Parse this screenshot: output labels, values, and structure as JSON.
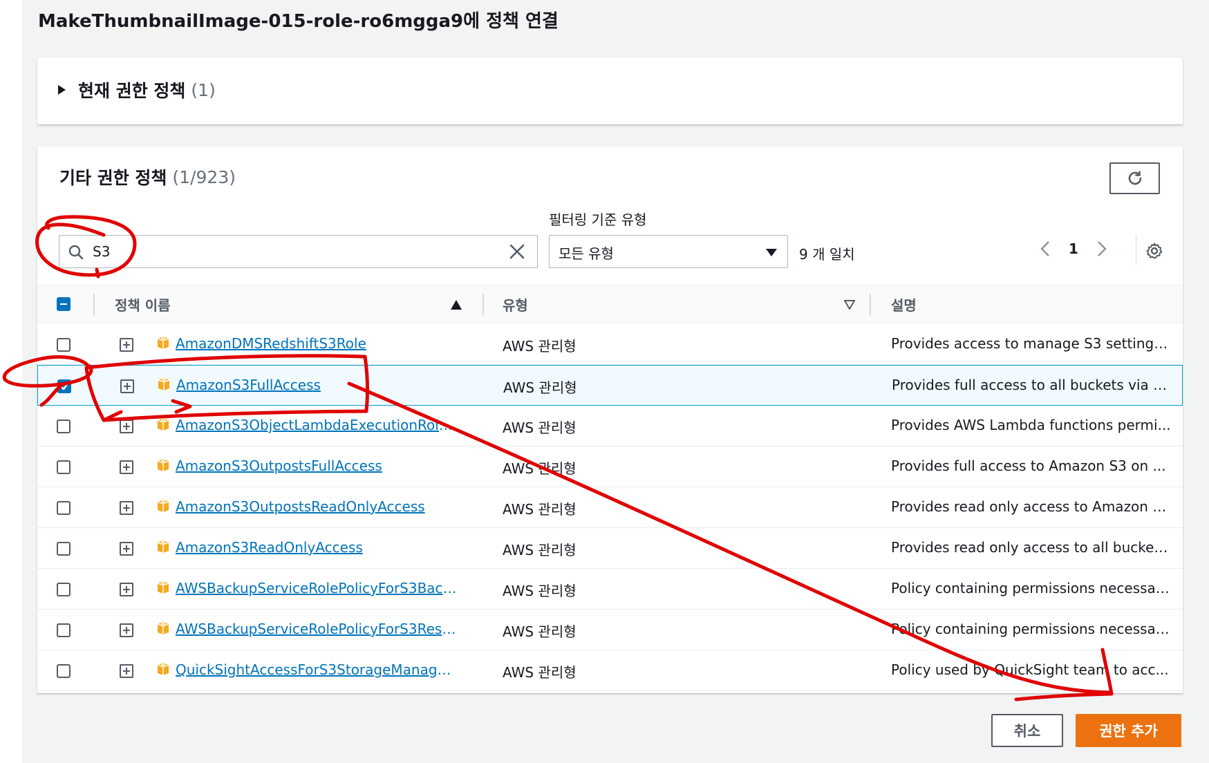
{
  "page": {
    "title": "MakeThumbnailImage-015-role-ro6mgga9에 정책 연결"
  },
  "current_policies": {
    "title": "현재 권한 정책",
    "count": "(1)"
  },
  "other_policies": {
    "title": "기타 권한 정책",
    "count": "(1/923)",
    "filter_type_label": "필터링 기준 유형",
    "search_value": "S3",
    "select_value": "모든 유형",
    "match_count": "9 개 일치",
    "page_number": "1",
    "columns": {
      "name": "정책 이름",
      "type": "유형",
      "description": "설명"
    },
    "rows": [
      {
        "name": "AmazonDMSRedshiftS3Role",
        "type": "AWS 관리형",
        "description": "Provides access to manage S3 settings ...",
        "checked": false
      },
      {
        "name": "AmazonS3FullAccess",
        "type": "AWS 관리형",
        "description": "Provides full access to all buckets via t...",
        "checked": true
      },
      {
        "name": "AmazonS3ObjectLambdaExecutionRoleP...",
        "type": "AWS 관리형",
        "description": "Provides AWS Lambda functions permi...",
        "checked": false
      },
      {
        "name": "AmazonS3OutpostsFullAccess",
        "type": "AWS 관리형",
        "description": "Provides full access to Amazon S3 on ...",
        "checked": false
      },
      {
        "name": "AmazonS3OutpostsReadOnlyAccess",
        "type": "AWS 관리형",
        "description": "Provides read only access to Amazon S...",
        "checked": false
      },
      {
        "name": "AmazonS3ReadOnlyAccess",
        "type": "AWS 관리형",
        "description": "Provides read only access to all bucket...",
        "checked": false
      },
      {
        "name": "AWSBackupServiceRolePolicyForS3Backup",
        "type": "AWS 관리형",
        "description": "Policy containing permissions necessar...",
        "checked": false
      },
      {
        "name": "AWSBackupServiceRolePolicyForS3Restore",
        "type": "AWS 관리형",
        "description": "Policy containing permissions necessar...",
        "checked": false
      },
      {
        "name": "QuickSightAccessForS3StorageManagem...",
        "type": "AWS 관리형",
        "description": "Policy used by QuickSight team to acc...",
        "checked": false
      }
    ]
  },
  "footer": {
    "cancel_label": "취소",
    "add_label": "권한 추가"
  },
  "colors": {
    "link": "#0073bb",
    "primary_button": "#ec7211",
    "annotation": "#e00000"
  },
  "icons": {
    "search": "search-icon",
    "clear": "close-icon",
    "refresh": "refresh-icon",
    "settings": "gear-icon",
    "policy": "policy-package-icon"
  }
}
